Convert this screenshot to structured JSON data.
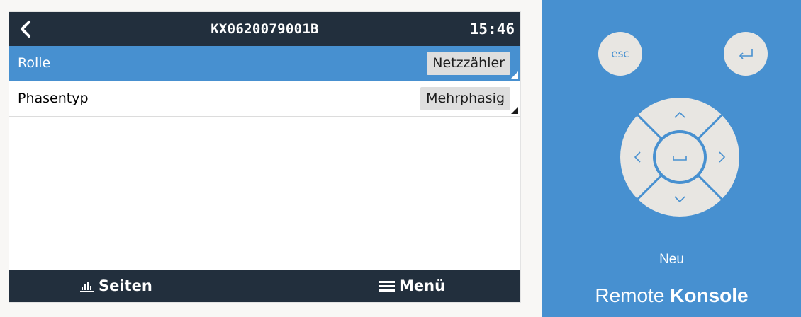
{
  "device": {
    "title": "KX0620079001B",
    "clock": "15:46"
  },
  "rows": [
    {
      "label": "Rolle",
      "value": "Netzzähler",
      "selected": true
    },
    {
      "label": "Phasentyp",
      "value": "Mehrphasig",
      "selected": false
    }
  ],
  "footer": {
    "pages_label": "Seiten",
    "menu_label": "Menü"
  },
  "remote": {
    "esc_label": "esc",
    "neu_label": "Neu",
    "brand_light": "Remote",
    "brand_bold": "Konsole"
  },
  "icons": {
    "back": "chevron-left-icon",
    "pages": "bar-chart-icon",
    "menu": "hamburger-icon",
    "enter": "enter-return-icon",
    "dpad": [
      "chevron-up-icon",
      "chevron-down-icon",
      "chevron-left-icon",
      "chevron-right-icon",
      "space-icon"
    ]
  },
  "colors": {
    "header_bg": "#222f3d",
    "selected_row": "#4790d0",
    "remote_bg": "#4790d0",
    "button_bg": "#e8e6e2"
  }
}
